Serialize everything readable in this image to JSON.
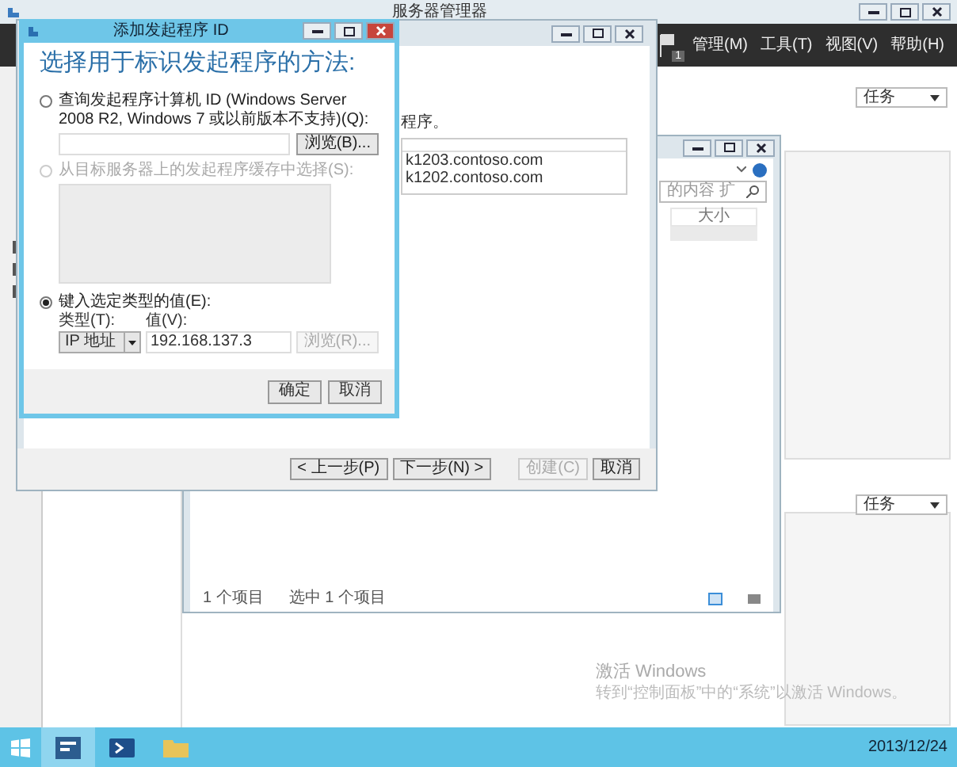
{
  "server_manager": {
    "title": "服务器管理器",
    "menu": [
      "管理(M)",
      "工具(T)",
      "视图(V)",
      "帮助(H)"
    ],
    "notification_count": "1",
    "task_buttons": [
      "任务",
      "任务"
    ]
  },
  "wizard": {
    "intro_text": "程序。",
    "list_rows": [
      "k1203.contoso.com",
      "k1202.contoso.com"
    ],
    "buttons": [
      {
        "label": "< 上一步(P)",
        "disabled": false
      },
      {
        "label": "下一步(N) >",
        "disabled": false
      },
      {
        "label": "创建(C)",
        "disabled": true
      },
      {
        "label": "取消",
        "disabled": false
      }
    ]
  },
  "explorer": {
    "search_placeholder": "的内容 扩",
    "column": "大小",
    "status": [
      "1 个项目",
      "选中 1 个项目"
    ]
  },
  "dialog": {
    "title": "添加发起程序 ID",
    "heading": "选择用于标识发起程序的方法:",
    "options": [
      {
        "label": "查询发起程序计算机 ID (Windows Server 2008 R2, Windows 7 或以前版本不支持)(Q):",
        "selected": false,
        "disabled": false
      },
      {
        "label": "从目标服务器上的发起程序缓存中选择(S):",
        "selected": false,
        "disabled": true
      },
      {
        "label": "键入选定类型的值(E):",
        "selected": true,
        "disabled": false
      }
    ],
    "browse_button": {
      "label": "浏览(B)...",
      "disabled": false
    },
    "type_label": "类型(T):",
    "type_value": "IP 地址",
    "value_label": "值(V):",
    "value": "192.168.137.3",
    "browse_value_button": {
      "label": "浏览(R)...",
      "disabled": true
    },
    "ok": "确定",
    "cancel": "取消"
  },
  "activation": {
    "title": "激活 Windows",
    "text": "转到“控制面板”中的“系统”以激活 Windows。"
  },
  "taskbar": {
    "clock": "2013/12/24"
  }
}
